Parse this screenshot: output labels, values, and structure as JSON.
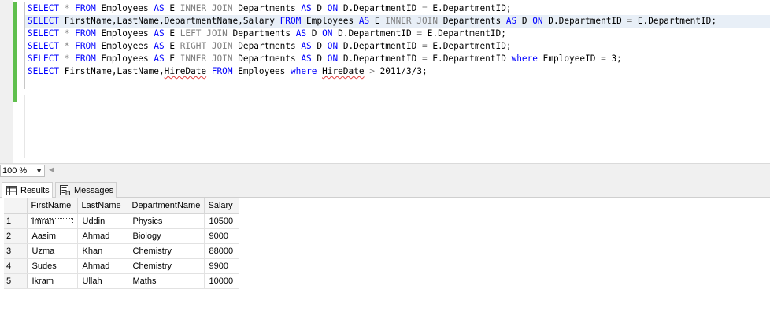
{
  "editor": {
    "lines": [
      [
        {
          "t": "SELECT",
          "c": "kw"
        },
        {
          "t": " "
        },
        {
          "t": "*",
          "c": "gy"
        },
        {
          "t": " "
        },
        {
          "t": "FROM",
          "c": "kw"
        },
        {
          "t": " Employees "
        },
        {
          "t": "AS",
          "c": "kw"
        },
        {
          "t": " E "
        },
        {
          "t": "INNER JOIN",
          "c": "gy"
        },
        {
          "t": " Departments "
        },
        {
          "t": "AS",
          "c": "kw"
        },
        {
          "t": " D "
        },
        {
          "t": "ON",
          "c": "kw"
        },
        {
          "t": " D.DepartmentID "
        },
        {
          "t": "=",
          "c": "gy"
        },
        {
          "t": " E.DepartmentID;"
        }
      ],
      [
        {
          "t": "SELECT",
          "c": "kw"
        },
        {
          "t": " FirstName,LastName,DepartmentName,Salary "
        },
        {
          "t": "FROM",
          "c": "kw"
        },
        {
          "t": " Employees "
        },
        {
          "t": "AS",
          "c": "kw"
        },
        {
          "t": " E "
        },
        {
          "t": "INNER JOIN",
          "c": "gy"
        },
        {
          "t": " Departments "
        },
        {
          "t": "AS",
          "c": "kw"
        },
        {
          "t": " D "
        },
        {
          "t": "ON",
          "c": "kw"
        },
        {
          "t": " D.DepartmentID "
        },
        {
          "t": "=",
          "c": "gy"
        },
        {
          "t": " E.DepartmentID;"
        }
      ],
      [
        {
          "t": "SELECT",
          "c": "kw"
        },
        {
          "t": " "
        },
        {
          "t": "*",
          "c": "gy"
        },
        {
          "t": " "
        },
        {
          "t": "FROM",
          "c": "kw"
        },
        {
          "t": " Employees "
        },
        {
          "t": "AS",
          "c": "kw"
        },
        {
          "t": " E "
        },
        {
          "t": "LEFT JOIN",
          "c": "gy"
        },
        {
          "t": " Departments "
        },
        {
          "t": "AS",
          "c": "kw"
        },
        {
          "t": " D "
        },
        {
          "t": "ON",
          "c": "kw"
        },
        {
          "t": " D.DepartmentID "
        },
        {
          "t": "=",
          "c": "gy"
        },
        {
          "t": " E.DepartmentID;"
        }
      ],
      [
        {
          "t": "SELECT",
          "c": "kw"
        },
        {
          "t": " "
        },
        {
          "t": "*",
          "c": "gy"
        },
        {
          "t": " "
        },
        {
          "t": "FROM",
          "c": "kw"
        },
        {
          "t": " Employees "
        },
        {
          "t": "AS",
          "c": "kw"
        },
        {
          "t": " E "
        },
        {
          "t": "RIGHT JOIN",
          "c": "gy"
        },
        {
          "t": " Departments "
        },
        {
          "t": "AS",
          "c": "kw"
        },
        {
          "t": " D "
        },
        {
          "t": "ON",
          "c": "kw"
        },
        {
          "t": " D.DepartmentID "
        },
        {
          "t": "=",
          "c": "gy"
        },
        {
          "t": " E.DepartmentID;"
        }
      ],
      [
        {
          "t": "SELECT",
          "c": "kw"
        },
        {
          "t": " "
        },
        {
          "t": "*",
          "c": "gy"
        },
        {
          "t": " "
        },
        {
          "t": "FROM",
          "c": "kw"
        },
        {
          "t": " Employees "
        },
        {
          "t": "AS",
          "c": "kw"
        },
        {
          "t": " E "
        },
        {
          "t": "INNER JOIN",
          "c": "gy"
        },
        {
          "t": " Departments "
        },
        {
          "t": "AS",
          "c": "kw"
        },
        {
          "t": " D "
        },
        {
          "t": "ON",
          "c": "kw"
        },
        {
          "t": " D.DepartmentID "
        },
        {
          "t": "=",
          "c": "gy"
        },
        {
          "t": " E.DepartmentID "
        },
        {
          "t": "where",
          "c": "kw"
        },
        {
          "t": " EmployeeID "
        },
        {
          "t": "=",
          "c": "gy"
        },
        {
          "t": " 3;"
        }
      ],
      [
        {
          "t": "SELECT",
          "c": "kw"
        },
        {
          "t": " FirstName,LastName,"
        },
        {
          "t": "HireDate",
          "c": "sq"
        },
        {
          "t": " "
        },
        {
          "t": "FROM",
          "c": "kw"
        },
        {
          "t": " Employees "
        },
        {
          "t": "where",
          "c": "kw"
        },
        {
          "t": " "
        },
        {
          "t": "HireDate",
          "c": "sq"
        },
        {
          "t": " "
        },
        {
          "t": ">",
          "c": "gy"
        },
        {
          "t": " 2011/3/3;"
        }
      ]
    ],
    "highlighted_line": 1
  },
  "zoom": {
    "value": "100 %"
  },
  "tabs": {
    "results_label": "Results",
    "messages_label": "Messages"
  },
  "results": {
    "columns": [
      "FirstName",
      "LastName",
      "DepartmentName",
      "Salary"
    ],
    "rows": [
      [
        "1",
        "Imran",
        "Uddin",
        "Physics",
        "10500"
      ],
      [
        "2",
        "Aasim",
        "Ahmad",
        "Biology",
        "9000"
      ],
      [
        "3",
        "Uzma",
        "Khan",
        "Chemistry",
        "88000"
      ],
      [
        "4",
        "Sudes",
        "Ahmad",
        "Chemistry",
        "9900"
      ],
      [
        "5",
        "Ikram",
        "Ullah",
        "Maths",
        "10000"
      ]
    ]
  },
  "colors": {
    "keyword": "#0000ff",
    "operator": "#808080",
    "change_bar": "#5fbf4d",
    "line_highlight": "#e8eff7"
  }
}
